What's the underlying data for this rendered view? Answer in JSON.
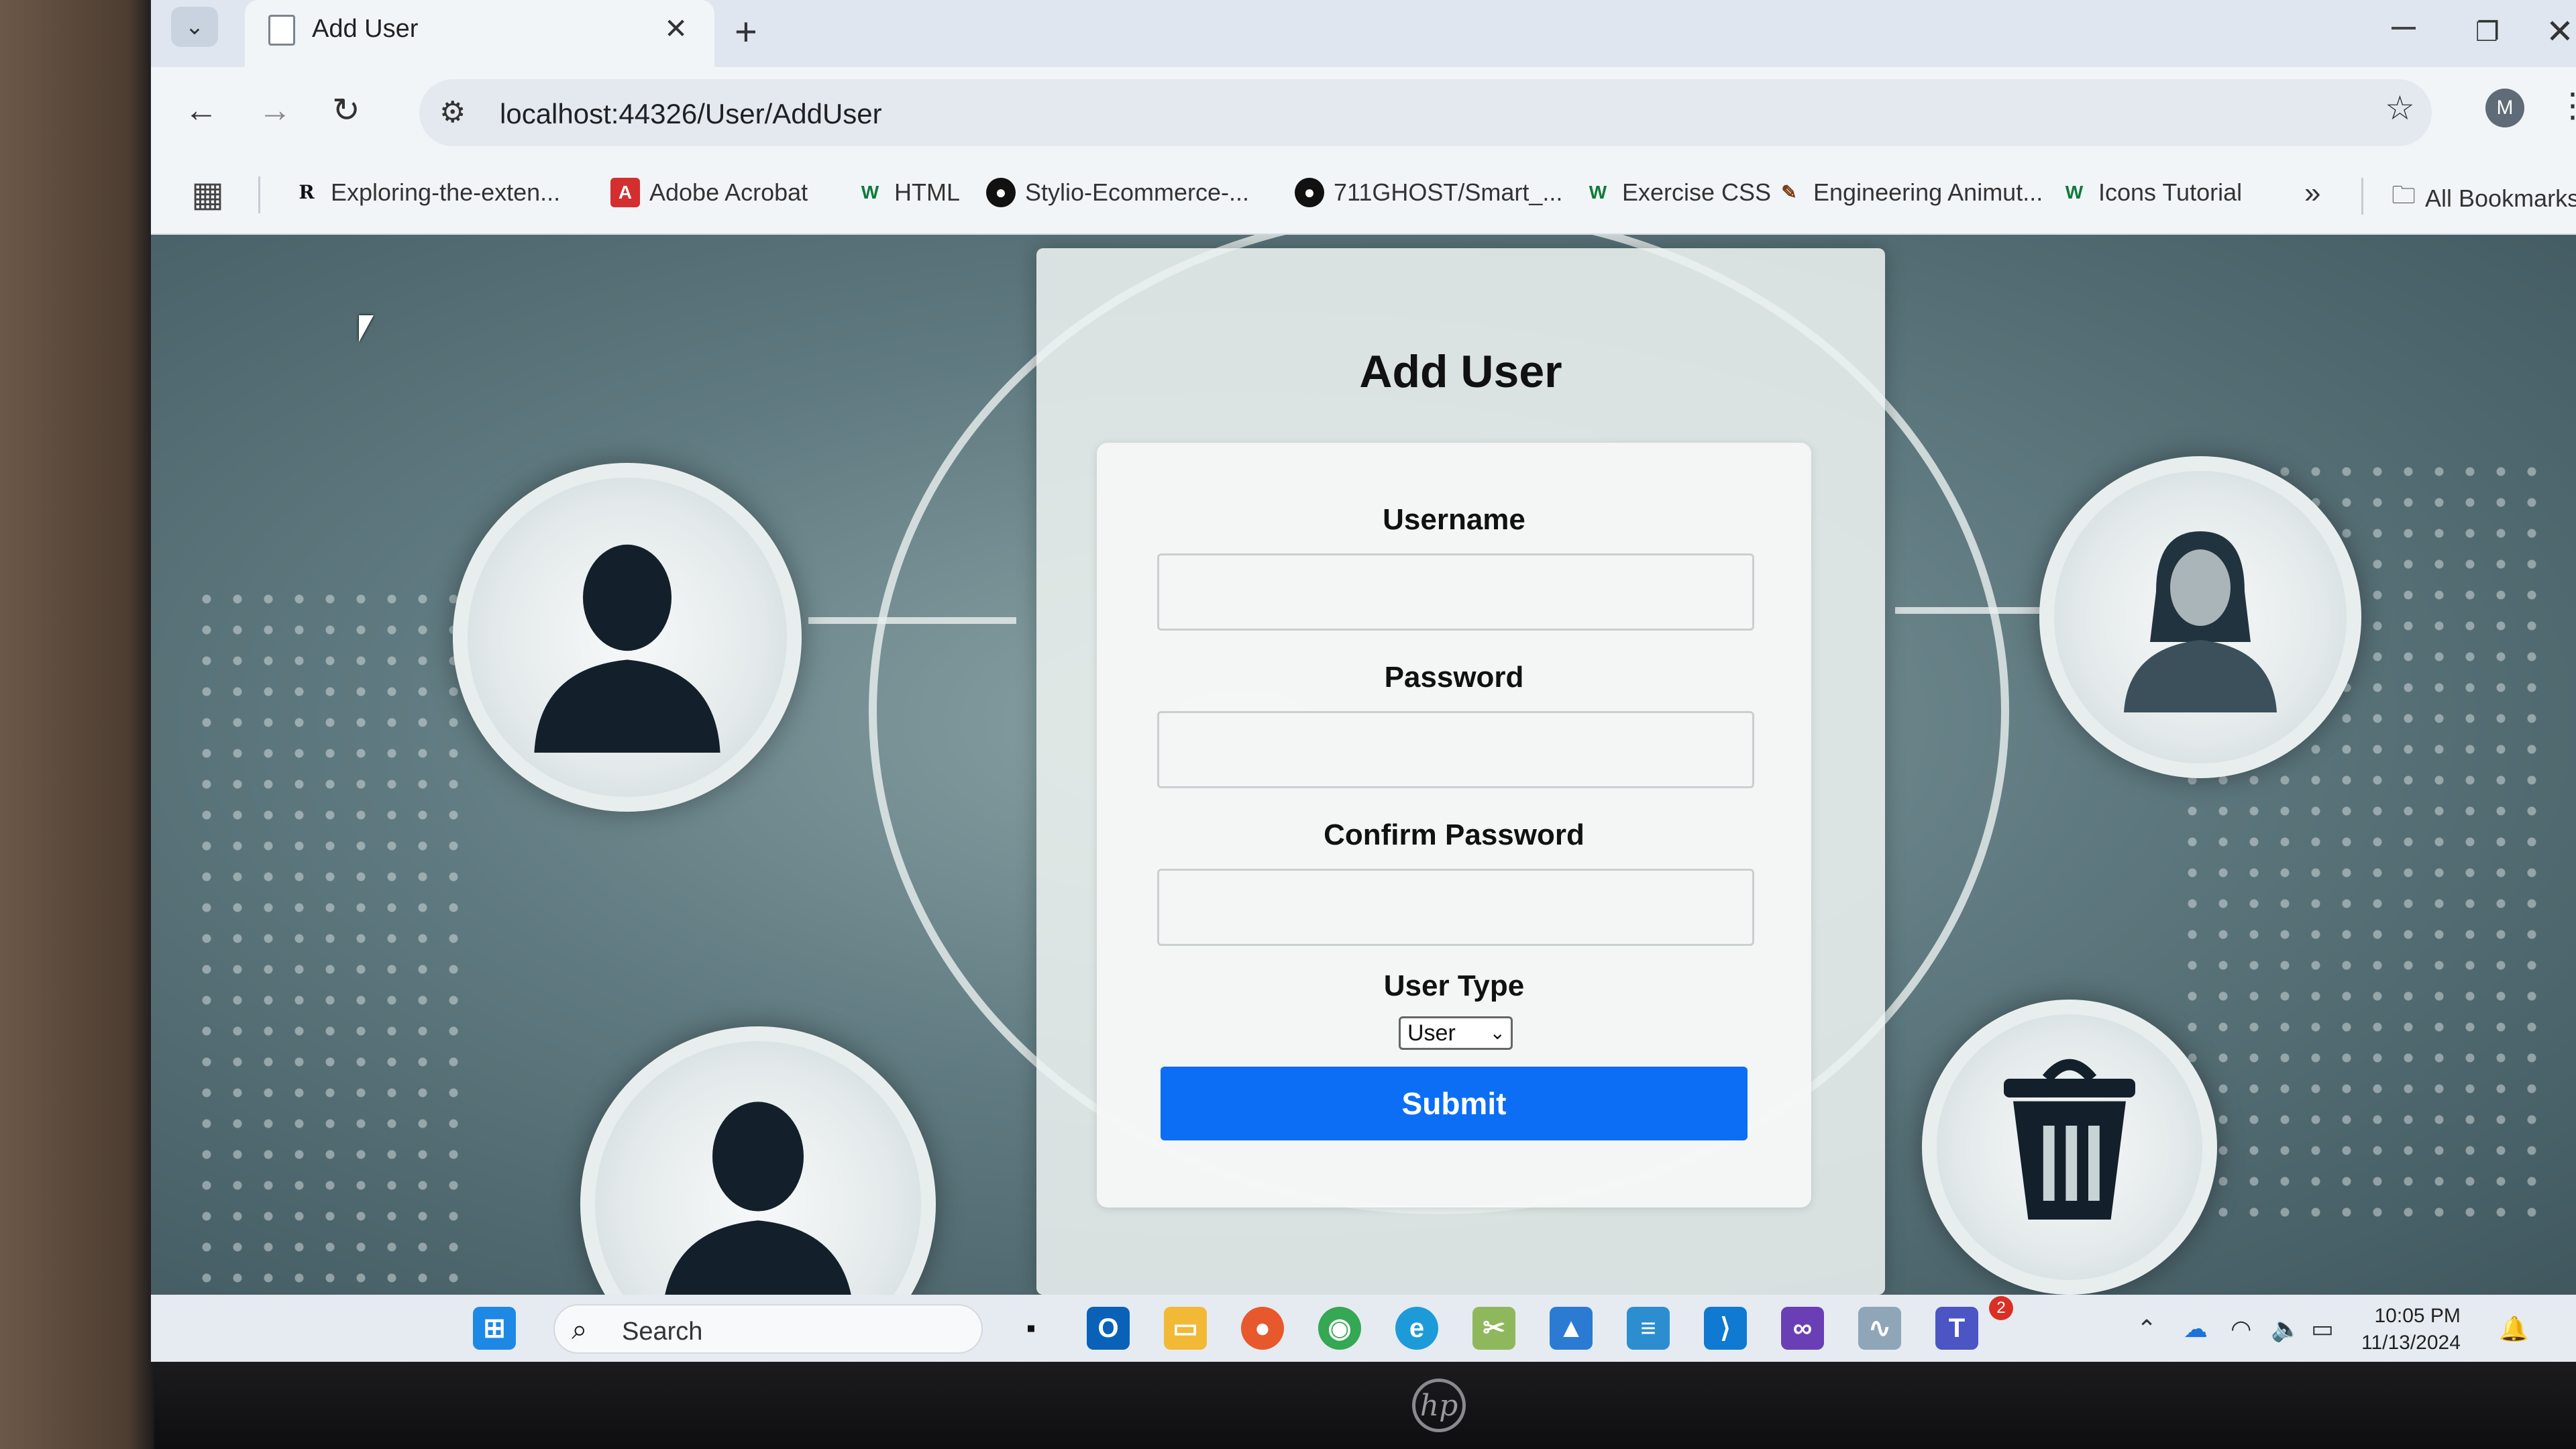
{
  "browser": {
    "tab_title": "Add User",
    "tab_close": "✕",
    "new_tab": "+",
    "url": "localhost:44326/User/AddUser"
  },
  "bookmarks": [
    {
      "label": "Exploring-the-exten...",
      "icon": "R",
      "color": "#ffffff"
    },
    {
      "label": "Adobe Acrobat",
      "icon": "A",
      "color": "#d32f2f"
    },
    {
      "label": "HTML",
      "icon": "W",
      "color": "#0f7a3b"
    },
    {
      "label": "Stylio-Ecommerce-...",
      "icon": "github",
      "color": "#111111"
    },
    {
      "label": "711GHOST/Smart_...",
      "icon": "github",
      "color": "#111111"
    },
    {
      "label": "Exercise CSS",
      "icon": "W",
      "color": "#0f7a3b"
    },
    {
      "label": "Engineering Animut...",
      "icon": "E",
      "color": "#7a3b0f"
    },
    {
      "label": "Icons Tutorial",
      "icon": "W",
      "color": "#0f7a3b"
    }
  ],
  "bookmarks_all": "All Bookmarks",
  "form": {
    "title": "Add User",
    "username_label": "Username",
    "username_value": "",
    "password_label": "Password",
    "password_value": "",
    "confirm_label": "Confirm Password",
    "confirm_value": "",
    "usertype_label": "User Type",
    "usertype_selected": "User",
    "submit_label": "Submit"
  },
  "taskbar": {
    "search_placeholder": "Search",
    "time": "10:05 PM",
    "date": "11/13/2024",
    "teams_badge": "2"
  },
  "profile_initial": "M",
  "colors": {
    "submit": "#0b6ef5",
    "browser_chrome": "#f2f5f8"
  }
}
